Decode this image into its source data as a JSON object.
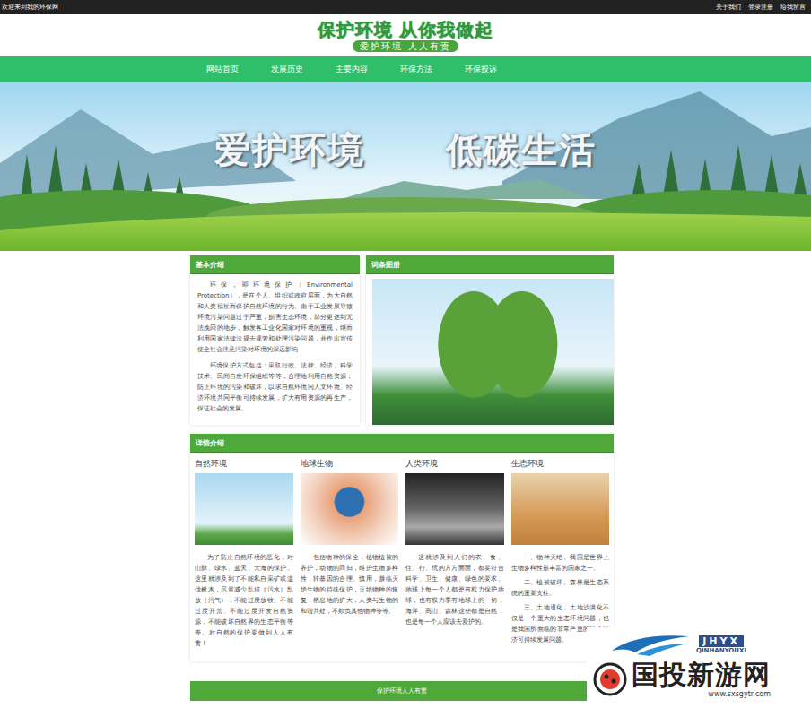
{
  "topbar": {
    "welcome": "欢迎来到我的环保网",
    "links": [
      "关于我们",
      "登录注册",
      "给我留言"
    ]
  },
  "logo": {
    "title": "保护环境 从你我做起",
    "subtitle": "爱护环境 人人有责"
  },
  "nav": [
    "网站首页",
    "发展历史",
    "主要内容",
    "环保方法",
    "环保投诉"
  ],
  "banner": {
    "slogans": [
      "爱护环境",
      "低碳生活"
    ]
  },
  "intro": {
    "title": "基本介绍",
    "paragraphs": [
      "环保，即环境保护（Environmental Protection），是在个人、组织或政府层面，为大自然和人类福祉而保护自然环境的行为。由于工业发展导致环境污染问题过于严重，损害生态环境，部分更达到无法挽回的地步，触发各工业化国家对环境的重视，继而利用国家法律法规去规管和处理污染问题，并作出宣传使全社会注意污染对环境的深远影响",
      "环境保护方式包括：采取行政、法律、经济、科学技术、民间自发环保组织等等，合理地利用自然资源，防止环境的污染和破坏，以求自然环境同人文环境、经济环境共同平衡可持续发展，扩大有用资源的再生产，保证社会的发展。"
    ]
  },
  "gallery": {
    "title": "词条图册"
  },
  "details": {
    "title": "详情介绍",
    "items": [
      {
        "title": "自然环境",
        "paragraphs": [
          "为了防止自然环境的恶化，对山脉、绿水、蓝天、大海的保护。这里就涉及到了不能私自采矿或滥伐树木，尽量减少乱排（污水）乱放（污气），不能过度放牧、不能过度开荒、不能过度开发自然资源，不能破坏自然界的生态平衡等等。对自然的保护要做到人人有责！"
        ]
      },
      {
        "title": "地球生物",
        "paragraphs": [
          "包括物种的保全，植物植被的养护，动物的回归，维护生物多样性，转基因的合理、慎用，濒临灭绝生物的特殊保护，灭绝物种的恢复，栖息地的扩大，人类与生物的和谐共处，不欺负其他物种等等。"
        ]
      },
      {
        "title": "人类环境",
        "paragraphs": [
          "这就涉及到人们的衣、食、住、行、玩的方方面面，都要符合科学、卫生、健康、绿色的要求。地球上每一个人都是有权力保护地球，也有权力享有地球上的一切，海洋、高山、森林这些都是自然，也是每一个人应该去爱护的。"
        ]
      },
      {
        "title": "生态环境",
        "paragraphs": [
          "一、物种灭绝。我国是世界上生物多样性最丰富的国家之一。",
          "二、植被破坏。森林是生态系统的重要支柱。",
          "三、土地退化。土地沙漠化不仅是一个重大的生态环境问题，也是我国所面临的非常严重的社会经济可持续发展问题。"
        ]
      }
    ]
  },
  "footer": {
    "text": "保护环境人人有责"
  },
  "watermark": {
    "brand": "JHYX",
    "latin": "QINHANYOUXI",
    "name": "国投新游网",
    "url": "www.sxsgytr.com"
  }
}
